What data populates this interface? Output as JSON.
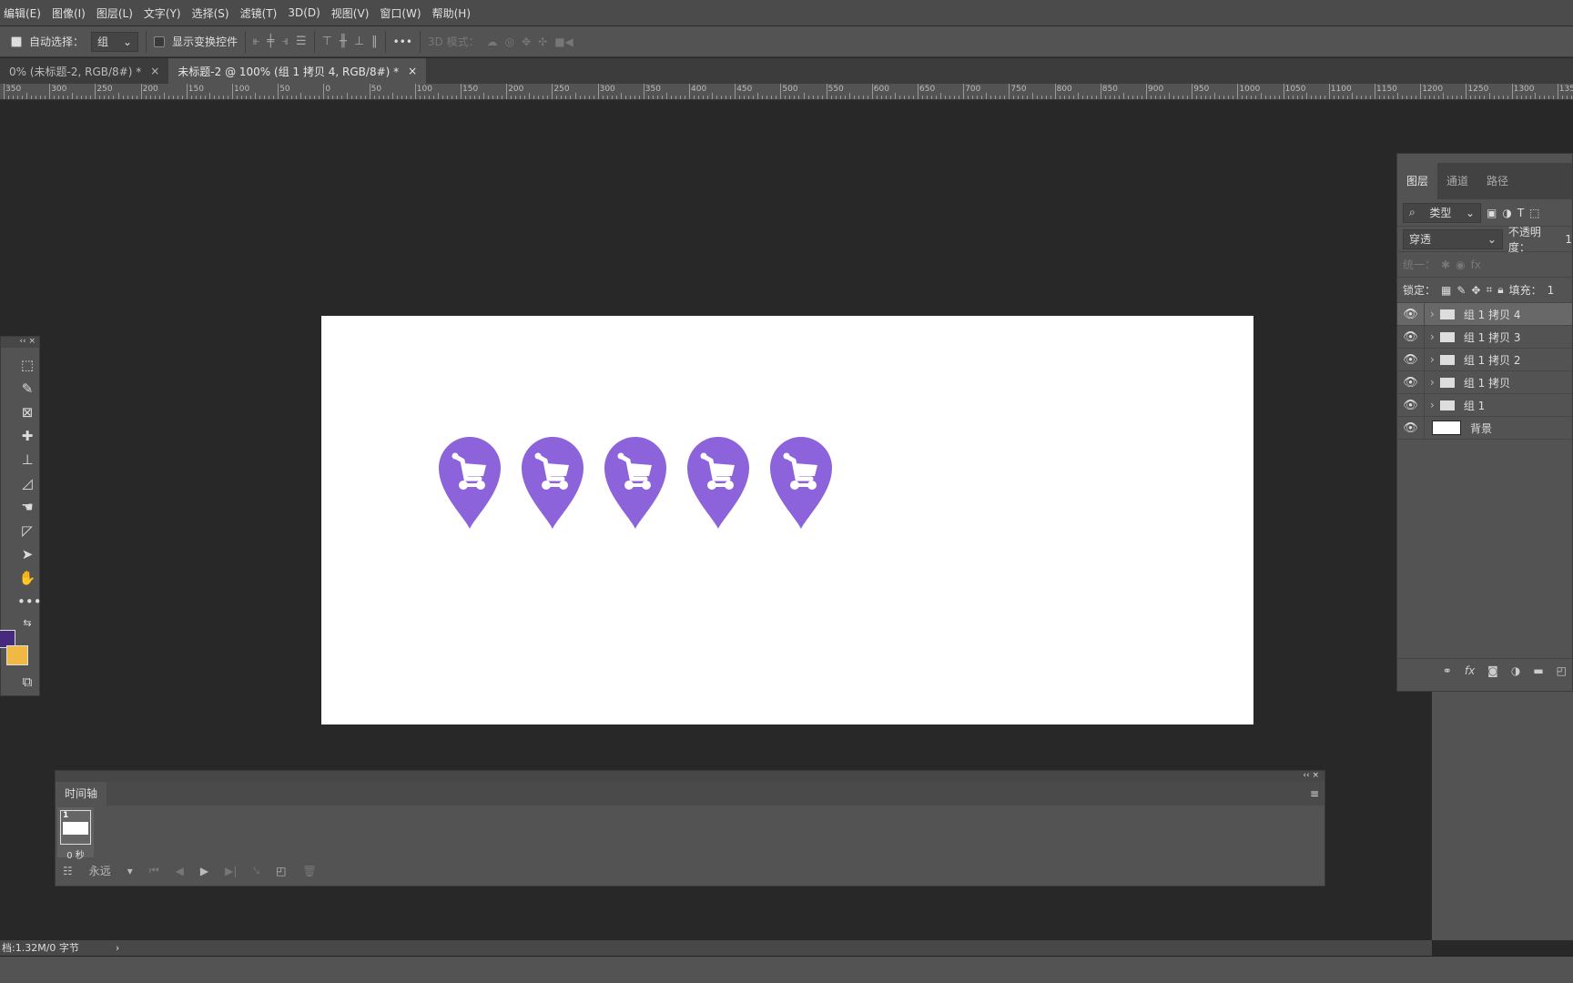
{
  "menu": [
    "编辑(E)",
    "图像(I)",
    "图层(L)",
    "文字(Y)",
    "选择(S)",
    "滤镜(T)",
    "3D(D)",
    "视图(V)",
    "窗口(W)",
    "帮助(H)"
  ],
  "options": {
    "auto_select_label": "自动选择：",
    "auto_select_value": "组",
    "show_transform_label": "显示变换控件",
    "more": "•••",
    "mode_3d": "3D 模式："
  },
  "tabs": [
    {
      "label": "0% (未标题-2, RGB/8#) *",
      "close": "×"
    },
    {
      "label": "未标题-2 @ 100% (组 1 拷贝 4, RGB/8#) *",
      "close": "×"
    }
  ],
  "ruler": [
    "350",
    "300",
    "250",
    "200",
    "150",
    "100",
    "50",
    "0",
    "50",
    "100",
    "150",
    "200",
    "250",
    "300",
    "350",
    "400",
    "450",
    "500",
    "550",
    "600",
    "650",
    "700",
    "750",
    "800",
    "850",
    "900",
    "950",
    "1000",
    "1050",
    "1100",
    "1150",
    "1200",
    "1250",
    "1300",
    "1350"
  ],
  "canvas": {
    "pin_color": "#8c63db",
    "pin_count": 5
  },
  "colors": {
    "foreground": "#452a7e",
    "background": "#f0b845"
  },
  "layers_panel": {
    "tabs": [
      "图层",
      "通道",
      "路径"
    ],
    "filter": "类型",
    "blend": "穿透",
    "opacity_label": "不透明度：",
    "opacity_value": "1",
    "unify_label": "统一：",
    "lock_label": "锁定：",
    "fill_label": "填充：",
    "fill_value": "1",
    "layers": [
      {
        "name": "组 1 拷贝 4",
        "type": "group",
        "selected": true
      },
      {
        "name": "组 1 拷贝 3",
        "type": "group"
      },
      {
        "name": "组 1 拷贝 2",
        "type": "group"
      },
      {
        "name": "组 1 拷贝",
        "type": "group"
      },
      {
        "name": "组 1",
        "type": "group"
      },
      {
        "name": "背景",
        "type": "pixel"
      }
    ]
  },
  "timeline": {
    "title": "时间轴",
    "frame_number": "1",
    "frame_delay": "0 秒",
    "loop": "永远"
  },
  "status": {
    "doc": "档:1.32M/0 字节"
  }
}
